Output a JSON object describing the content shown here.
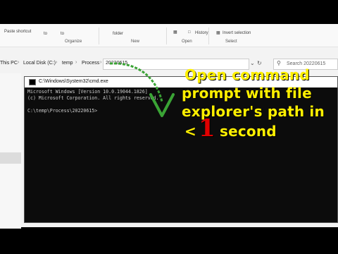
{
  "ribbon": {
    "paste_shortcut": "Paste shortcut",
    "to_1": "to",
    "to_2": "to",
    "folder": "folder",
    "history": "History",
    "invert_selection": "Invert selection",
    "groups": [
      "Organize",
      "New",
      "Open",
      "Select"
    ]
  },
  "address": {
    "crumbs": [
      "This PC",
      "Local Disk (C:)",
      "temp",
      "Process",
      "20220615"
    ],
    "search_placeholder": "Search 20220615"
  },
  "cmd": {
    "title": "C:\\Windows\\System32\\cmd.exe",
    "lines": [
      "Microsoft Windows [Version 10.0.19044.1826]",
      "(c) Microsoft Corporation. All rights reserved.",
      "",
      "C:\\temp\\Process\\20220615>"
    ]
  },
  "caption": {
    "line1": "Open  command",
    "line2": "prompt  with  file",
    "line3": "explorer's  path  in",
    "line4_prefix": "<",
    "line4_number": "1",
    "line4_suffix": "second"
  },
  "colors": {
    "caption_text": "#fff000",
    "caption_number": "#e00000",
    "arrow": "#3aa335",
    "cmd_bg": "#0c0c0c"
  }
}
